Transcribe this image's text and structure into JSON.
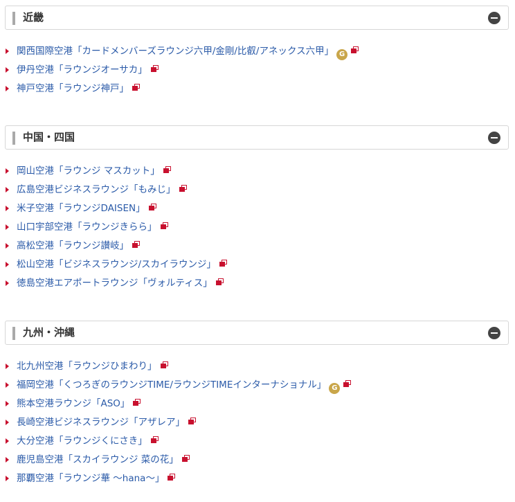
{
  "sections": [
    {
      "title": "近畿",
      "links": [
        {
          "label": "関西国際空港「カードメンバーズラウンジ六甲/金剛/比叡/アネックス六甲」",
          "badge": "G"
        },
        {
          "label": "伊丹空港「ラウンジオーサカ」"
        },
        {
          "label": "神戸空港「ラウンジ神戸」"
        }
      ]
    },
    {
      "title": "中国・四国",
      "links": [
        {
          "label": "岡山空港「ラウンジ マスカット」"
        },
        {
          "label": "広島空港ビジネスラウンジ「もみじ」"
        },
        {
          "label": "米子空港「ラウンジDAISEN」"
        },
        {
          "label": "山口宇部空港「ラウンジきらら」"
        },
        {
          "label": "高松空港「ラウンジ讃岐」"
        },
        {
          "label": "松山空港「ビジネスラウンジ/スカイラウンジ」"
        },
        {
          "label": "徳島空港エアポートラウンジ「ヴォルティス」"
        }
      ]
    },
    {
      "title": "九州・沖縄",
      "links": [
        {
          "label": "北九州空港「ラウンジひまわり」"
        },
        {
          "label": "福岡空港「くつろぎのラウンジTIME/ラウンジTIMEインターナショナル」",
          "badge": "G"
        },
        {
          "label": "熊本空港ラウンジ「ASO」"
        },
        {
          "label": "長崎空港ビジネスラウンジ「アザレア」"
        },
        {
          "label": "大分空港「ラウンジくにさき」"
        },
        {
          "label": "鹿児島空港「スカイラウンジ 菜の花」"
        },
        {
          "label": "那覇空港「ラウンジ華 ～hana～」"
        }
      ]
    }
  ],
  "icons": {
    "collapse": "minus-circle-icon",
    "external": "external-link-icon",
    "bullet": "triangle-right-icon",
    "gold_badge": "gold-card-badge"
  },
  "colors": {
    "link": "#2a5aa8",
    "bullet": "#c8102e",
    "badge": "#c9a64a"
  }
}
